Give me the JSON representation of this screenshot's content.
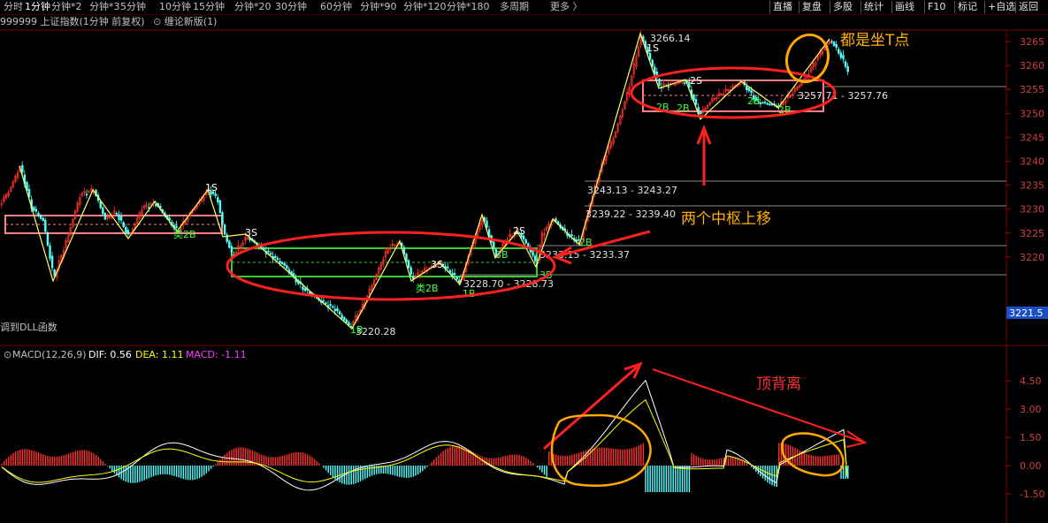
{
  "toolbar": {
    "periods": [
      "分时",
      "1分钟",
      "分钟*2",
      "分钟*3",
      "5分钟",
      "10分钟",
      "15分钟",
      "分钟*20",
      "30分钟",
      "60分钟",
      "分钟*90",
      "分钟*120",
      "分钟*180",
      "多周期",
      "更多 〉"
    ],
    "active_index": 1,
    "right_buttons": [
      "直播",
      "复盘",
      "多股",
      "统计",
      "画线",
      "F10",
      "标记",
      "+自选",
      "返回"
    ]
  },
  "title": {
    "main": "999999 上证指数(1分钟 前复权)",
    "indicator": "缠论新版(1)"
  },
  "price_axis": {
    "ticks": [
      "3265",
      "3260",
      "3255",
      "3250",
      "3245",
      "3240",
      "3235",
      "3230",
      "3225",
      "3220"
    ],
    "current": "3221.5"
  },
  "macd_axis": {
    "ticks": [
      "4.50",
      "3.00",
      "1.50",
      "0.00",
      "-1.50"
    ]
  },
  "macd_legend": {
    "name": "MACD(12,26,9)",
    "dif": "DIF: 0.56",
    "dea": "DEA: 1.11",
    "macd": "MACD: -1.11"
  },
  "dll_text": "调到DLL函数",
  "price_labels": {
    "high": "3266.14",
    "low": "3220.28",
    "zs1": "3243.13 - 3243.27",
    "zs2": "3239.22 - 3239.40",
    "zs3": "3233.15 - 3233.37",
    "zs4": "3228.70 - 3228.73",
    "zs5": "3257.71 - 3257.76"
  },
  "signals": [
    "1S",
    "3S",
    "3S",
    "2S",
    "1S",
    "2S",
    "类2B",
    "类2B",
    "2B",
    "3B",
    "2B",
    "3B",
    "1B",
    "1B",
    "2B",
    "2B",
    "2B"
  ],
  "annotations": {
    "t_point": "都是坐T点",
    "pivot_up": "两个中枢上移",
    "divergence": "顶背离"
  },
  "colors": {
    "up": "#ff3232",
    "down": "#54ffff",
    "box_green": "#33cc33",
    "box_pink": "#ff8080",
    "anno_red": "#ff2020",
    "anno_orange": "#ffa800",
    "text_yellow": "#ffff00",
    "label_orange": "#ffb000"
  }
}
